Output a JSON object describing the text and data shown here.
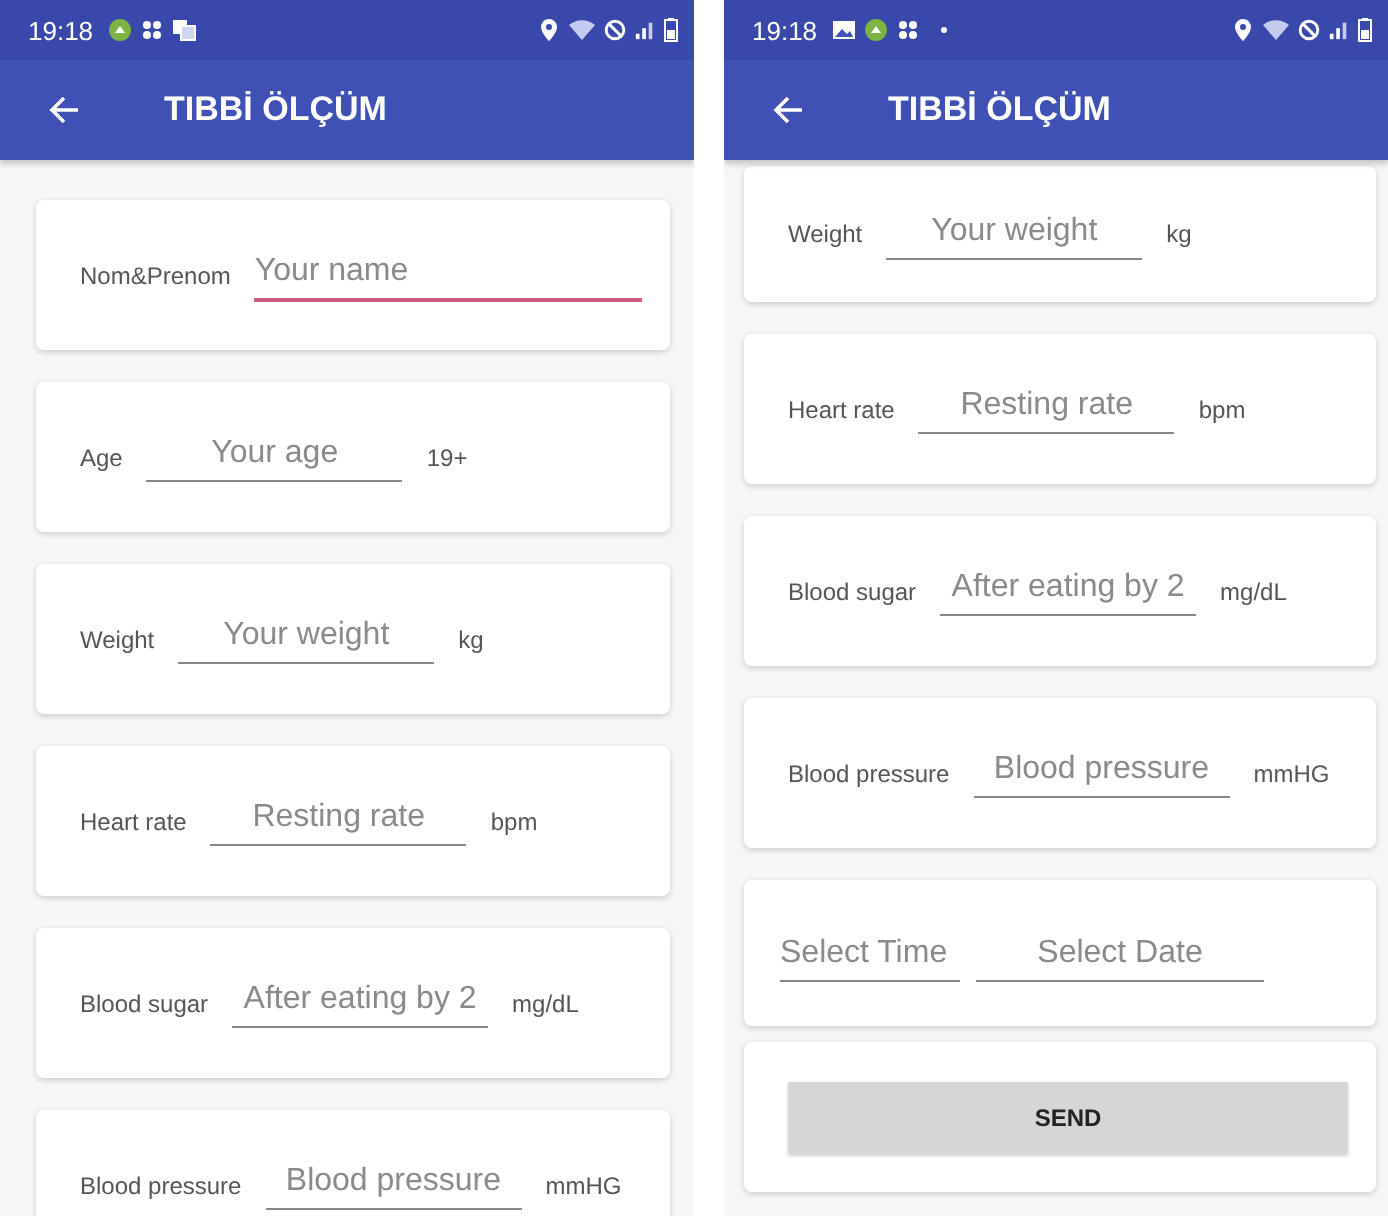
{
  "panes": [
    {
      "status_bar": {
        "time": "19:18",
        "notifications": [
          {
            "kind": "app"
          },
          {
            "kind": "grid"
          },
          {
            "kind": "translate"
          }
        ]
      },
      "title": "TIBBİ ÖLÇÜM",
      "rows": [
        {
          "kind": "field",
          "label": "Nom&Prenom",
          "placeholder": "Your name",
          "focused": true
        },
        {
          "kind": "field",
          "label": "Age",
          "placeholder": "Your age",
          "unit": "19+",
          "focused": false
        },
        {
          "kind": "field",
          "label": "Weight",
          "placeholder": "Your weight",
          "unit": "kg",
          "focused": false
        },
        {
          "kind": "field",
          "label": "Heart rate",
          "placeholder": "Resting rate",
          "unit": "bpm",
          "focused": false
        },
        {
          "kind": "field",
          "label": "Blood sugar",
          "placeholder": "After eating by 2",
          "unit": "mg/dL",
          "focused": false
        },
        {
          "kind": "field",
          "label": "Blood pressure",
          "placeholder": "Blood pressure",
          "unit": "mmHG",
          "focused": false
        }
      ]
    },
    {
      "status_bar": {
        "time": "19:18",
        "notifications": [
          {
            "kind": "image"
          },
          {
            "kind": "app"
          },
          {
            "kind": "grid"
          },
          {
            "kind": "dot"
          }
        ]
      },
      "title": "TIBBİ ÖLÇÜM",
      "rows": [
        {
          "kind": "field",
          "label": "Weight",
          "placeholder": "Your weight",
          "unit": "kg",
          "focused": false
        },
        {
          "kind": "field",
          "label": "Heart rate",
          "placeholder": "Resting rate",
          "unit": "bpm",
          "focused": false
        },
        {
          "kind": "field",
          "label": "Blood sugar",
          "placeholder": "After eating by 2",
          "unit": "mg/dL",
          "focused": false
        },
        {
          "kind": "field",
          "label": "Blood pressure",
          "placeholder": "Blood pressure",
          "unit": "mmHG",
          "focused": false
        },
        {
          "kind": "pickers",
          "time_placeholder": "Select Time",
          "date_placeholder": "Select Date"
        },
        {
          "kind": "button",
          "label": "SEND"
        }
      ]
    }
  ]
}
